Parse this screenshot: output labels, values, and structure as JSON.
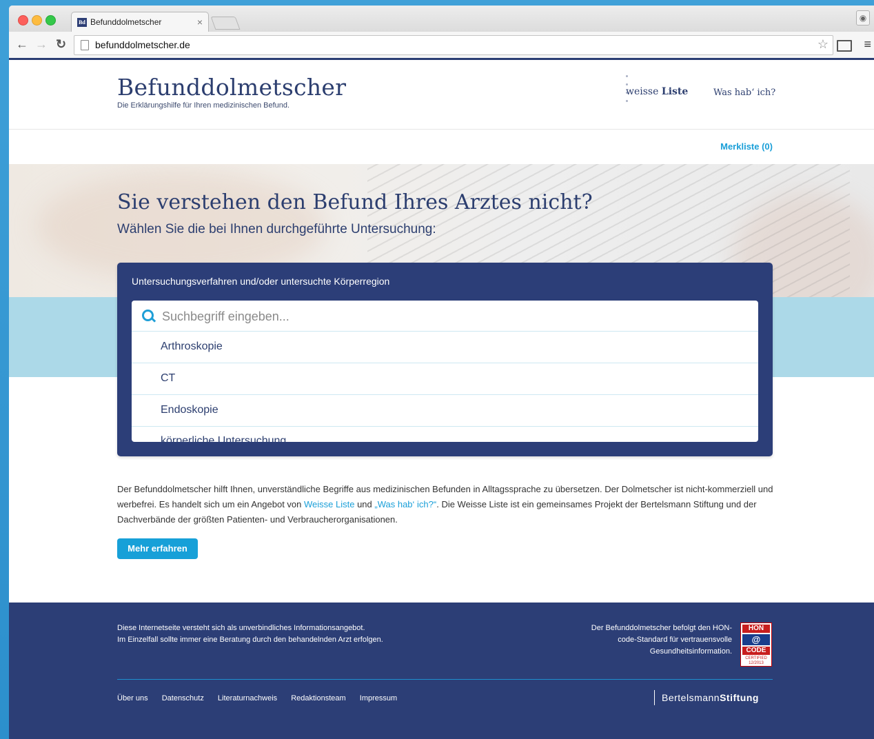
{
  "browser": {
    "tab_title": "Befunddolmetscher",
    "tab_favicon": "Bd",
    "url": "befunddolmetscher.de"
  },
  "header": {
    "logo_title": "Befunddolmetscher",
    "logo_subtitle": "Die Erklärungshilfe für Ihren medizinischen Befund.",
    "partner_weisse_a": "weisse",
    "partner_weisse_b": "Liste",
    "partner_wasab": "Was hab‘ ich?",
    "merkliste": "Merkliste (0)"
  },
  "hero": {
    "title": "Sie verstehen den Befund Ihres Arztes nicht?",
    "subtitle": "Wählen Sie die bei Ihnen durchgeführte Untersuchung:"
  },
  "search": {
    "label": "Untersuchungsverfahren und/oder untersuchte Körperregion",
    "placeholder": "Suchbegriff eingeben...",
    "options": [
      "Arthroskopie",
      "CT",
      "Endoskopie",
      "körperliche Untersuchung"
    ]
  },
  "intro": {
    "text_1": "Der Befunddolmetscher hilft Ihnen, unverständliche Begriffe aus medizinischen Befunden in Alltagssprache zu übersetzen. Der Dolmetscher ist nicht-kommerziell und werbefrei. Es handelt sich um ein Angebot von ",
    "link_1": "Weisse Liste",
    "text_2": " und ",
    "link_2": "„Was hab‘ ich?“",
    "text_3": ". Die Weisse Liste ist ein gemeinsames Projekt der Bertelsmann Stiftung und der Dachverbände der größten Patienten- und Verbraucherorganisationen.",
    "button": "Mehr erfahren"
  },
  "footer": {
    "disclaimer_1": "Diese Internetseite versteht sich als unverbindliches Informationsangebot.",
    "disclaimer_2": "Im Einzelfall sollte immer eine Beratung durch den behandelnden Arzt erfolgen.",
    "hon_1": "Der Befunddolmetscher befolgt den HON-",
    "hon_2": "code-Standard für vertrauensvolle",
    "hon_3": "Gesundheitsinformation.",
    "hon_badge_top": "HON",
    "hon_badge_mid": "@",
    "hon_badge_code": "CODE",
    "hon_badge_cert": "CERTIFIED 12/2013",
    "links": [
      "Über uns",
      "Datenschutz",
      "Literaturnachweis",
      "Redaktionsteam",
      "Impressum"
    ],
    "brand_a": "Bertelsmann",
    "brand_b": "Stiftung"
  },
  "icons": {
    "search": "search-icon",
    "star": "star-icon",
    "cast": "cast-icon",
    "menu": "menu-icon",
    "profile": "profile-icon"
  },
  "colors": {
    "navy": "#2c3e76",
    "accent": "#17a0d8",
    "band": "#acd9e8"
  }
}
